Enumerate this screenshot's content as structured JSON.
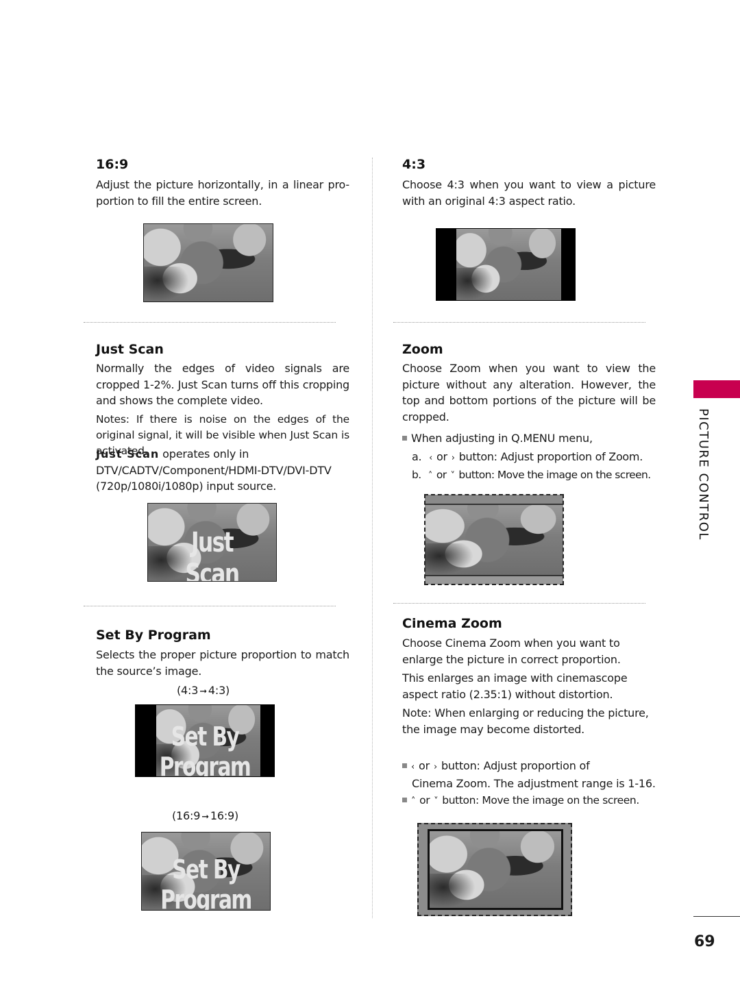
{
  "side_tab": {
    "label": "PICTURE CONTROL",
    "color": "#c8004f"
  },
  "page_number": "69",
  "sections": {
    "s169": {
      "title": "16:9",
      "body": "Adjust the picture horizontally, in a linear pro- portion to fill the entire screen."
    },
    "s43": {
      "title": "4:3",
      "body": "Choose 4:3 when you want to view a picture with an original 4:3 aspect ratio."
    },
    "just_scan": {
      "title": "Just Scan",
      "body1": "Normally the edges of video signals are cropped 1-2%. Just Scan turns off this cropping and shows the complete video.",
      "body2": "Notes: If there is noise on the edges of the original signal, it will be visible when Just Scan is activated.",
      "body3_bold": "Just Scan",
      "body3_rest": " operates only in",
      "body3_line2": "DTV/CADTV/Component/HDMI-DTV/DVI-DTV",
      "body3_line3": "(720p/1080i/1080p) input source.",
      "image_overlay": "Just Scan"
    },
    "zoom": {
      "title": "Zoom",
      "body": "Choose Zoom when you want to view the picture without any alteration. However, the top and bottom portions of the picture will be cropped.",
      "bullet": "When adjusting in Q.MENU menu,",
      "a_prefix": "a.",
      "a_or": "or",
      "a_text": "button: Adjust proportion of Zoom.",
      "b_prefix": "b.",
      "b_or": "or",
      "b_text": "button: Move the image on the screen."
    },
    "set_by_program": {
      "title": "Set By Program",
      "body": "Selects the proper picture proportion to match the source’s image.",
      "caption1_from": "(4:3",
      "caption1_to": "4:3)",
      "caption2_from": "(16:9",
      "caption2_to": "16:9)",
      "image_overlay": "Set By Program"
    },
    "cinema_zoom": {
      "title": "Cinema Zoom",
      "body1": "Choose Cinema Zoom when you want to enlarge the picture in correct proportion.",
      "body2": "This enlarges an image with cinemascope aspect ratio (2.35:1) without distortion.",
      "body3": "Note: When enlarging or reducing the picture, the image may become distorted.",
      "bullet1_or": "or",
      "bullet1_text": "button:  Adjust proportion of",
      "bullet1_line2": "Cinema Zoom. The adjustment range is 1-16.",
      "bullet2_or": "or",
      "bullet2_text": "button: Move the image on the screen."
    }
  },
  "icons": {
    "left": "‹",
    "right": "›",
    "up": "˄",
    "down": "˅",
    "arrow": "➞"
  }
}
